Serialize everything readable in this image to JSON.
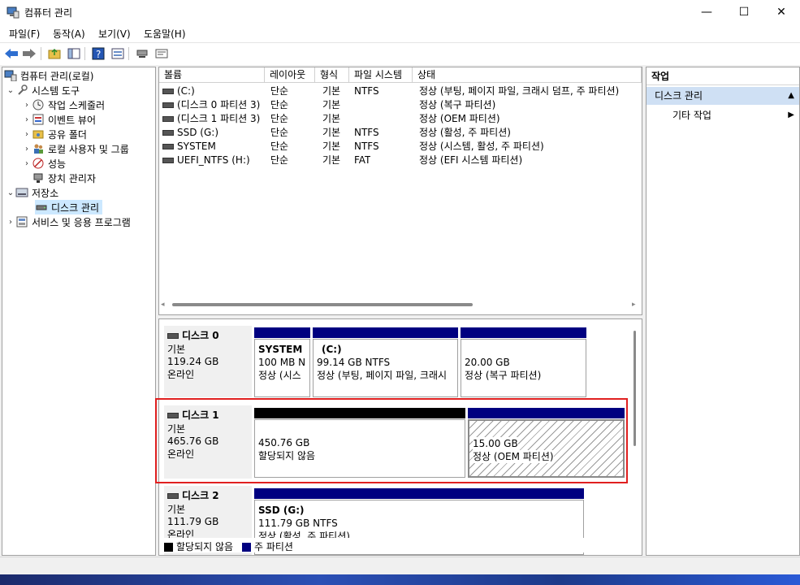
{
  "window": {
    "title": "컴퓨터 관리",
    "minimize_glyph": "—",
    "maximize_glyph": "☐",
    "close_glyph": "✕"
  },
  "menu": [
    "파일(F)",
    "동작(A)",
    "보기(V)",
    "도움말(H)"
  ],
  "toolbar": {
    "icons": [
      "back-arrow-icon",
      "forward-arrow-icon",
      "up-folder-icon",
      "show-hide-tree-icon",
      "help-icon",
      "properties-icon",
      "connect-icon",
      "export-icon"
    ]
  },
  "tree": {
    "root": "컴퓨터 관리(로컬)",
    "system_tools": "시스템 도구",
    "task_scheduler": "작업 스케줄러",
    "event_viewer": "이벤트 뷰어",
    "shared_folders": "공유 폴더",
    "local_users": "로컬 사용자 및 그룹",
    "performance": "성능",
    "device_manager": "장치 관리자",
    "storage": "저장소",
    "disk_management": "디스크 관리",
    "services": "서비스 및 응용 프로그램"
  },
  "volumes": {
    "columns": [
      "볼륨",
      "레이아웃",
      "형식",
      "파일 시스템",
      "상태"
    ],
    "rows": [
      {
        "volume": "(C:)",
        "layout": "단순",
        "type": "기본",
        "fs": "NTFS",
        "status": "정상 (부팅, 페이지 파일, 크래시 덤프, 주 파티션)"
      },
      {
        "volume": "(디스크 0 파티션 3)",
        "layout": "단순",
        "type": "기본",
        "fs": "",
        "status": "정상 (복구 파티션)"
      },
      {
        "volume": "(디스크 1 파티션 3)",
        "layout": "단순",
        "type": "기본",
        "fs": "",
        "status": "정상 (OEM 파티션)"
      },
      {
        "volume": "SSD (G:)",
        "layout": "단순",
        "type": "기본",
        "fs": "NTFS",
        "status": "정상 (활성, 주 파티션)"
      },
      {
        "volume": "SYSTEM",
        "layout": "단순",
        "type": "기본",
        "fs": "NTFS",
        "status": "정상 (시스템, 활성, 주 파티션)"
      },
      {
        "volume": "UEFI_NTFS (H:)",
        "layout": "단순",
        "type": "기본",
        "fs": "FAT",
        "status": "정상 (EFI 시스템 파티션)"
      }
    ]
  },
  "disks": {
    "disk0": {
      "name": "디스크 0",
      "kind": "기본",
      "size": "119.24 GB",
      "state": "온라인",
      "p1_name": "SYSTEM",
      "p1_line1": "100 MB N",
      "p1_line2": "정상 (시스",
      "p2_name": "(C:)",
      "p2_line1": "99.14 GB NTFS",
      "p2_line2": "정상 (부팅, 페이지 파일, 크래시",
      "p3_line1": "20.00 GB",
      "p3_line2": "정상 (복구 파티션)"
    },
    "disk1": {
      "name": "디스크 1",
      "kind": "기본",
      "size": "465.76 GB",
      "state": "온라인",
      "p1_line1": "450.76 GB",
      "p1_line2": "할당되지 않음",
      "p2_line1": "15.00 GB",
      "p2_line2": "정상 (OEM 파티션)"
    },
    "disk2": {
      "name": "디스크 2",
      "kind": "기본",
      "size": "111.79 GB",
      "state": "온라인",
      "p1_name": "SSD  (G:)",
      "p1_line1": "111.79 GB NTFS",
      "p1_line2": "정상 (활성, 주 파티션)"
    }
  },
  "legend": {
    "unallocated": "할당되지 않음",
    "primary": "주 파티션"
  },
  "actions": {
    "header": "작업",
    "section": "디스크 관리",
    "more": "기타 작업"
  },
  "colors": {
    "primary_bar": "#000080",
    "unalloc_bar": "#000000",
    "selection": "#cce8ff",
    "highlight": "#e02020"
  }
}
